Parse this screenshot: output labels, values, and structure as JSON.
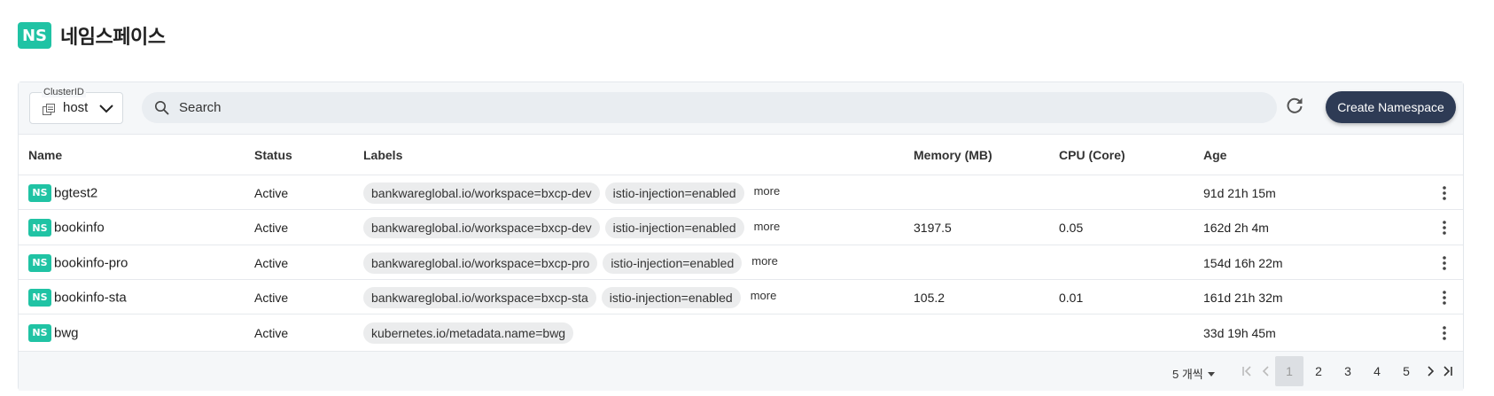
{
  "header": {
    "logo_text": "NS",
    "title": "네임스페이스"
  },
  "toolbar": {
    "cluster_label": "ClusterID",
    "cluster_value": "host",
    "search_placeholder": "Search",
    "search_value": "",
    "create_label": "Create Namespace"
  },
  "table": {
    "columns": {
      "name": "Name",
      "status": "Status",
      "labels": "Labels",
      "memory": "Memory (MB)",
      "cpu": "CPU (Core)",
      "age": "Age"
    },
    "more_label": "more",
    "badge_text": "NS",
    "rows": [
      {
        "name": "bgtest2",
        "status": "Active",
        "labels": [
          "bankwareglobal.io/workspace=bxcp-dev",
          "istio-injection=enabled"
        ],
        "memory": "",
        "cpu": "",
        "age": "91d 21h 15m"
      },
      {
        "name": "bookinfo",
        "status": "Active",
        "labels": [
          "bankwareglobal.io/workspace=bxcp-dev",
          "istio-injection=enabled"
        ],
        "memory": "3197.5",
        "cpu": "0.05",
        "age": "162d 2h 4m"
      },
      {
        "name": "bookinfo-pro",
        "status": "Active",
        "labels": [
          "bankwareglobal.io/workspace=bxcp-pro",
          "istio-injection=enabled"
        ],
        "memory": "",
        "cpu": "",
        "age": "154d 16h 22m"
      },
      {
        "name": "bookinfo-sta",
        "status": "Active",
        "labels": [
          "bankwareglobal.io/workspace=bxcp-sta",
          "istio-injection=enabled"
        ],
        "memory": "105.2",
        "cpu": "0.01",
        "age": "161d 21h 32m"
      },
      {
        "name": "bwg",
        "status": "Active",
        "labels": [
          "kubernetes.io/metadata.name=bwg"
        ],
        "memory": "",
        "cpu": "",
        "age": "33d 19h 45m"
      }
    ]
  },
  "pagination": {
    "page_size_label": "5 개씩",
    "pages": [
      "1",
      "2",
      "3",
      "4",
      "5"
    ],
    "current_page": "1"
  },
  "colors": {
    "accent": "#20c3a4",
    "button": "#2e3b55"
  }
}
